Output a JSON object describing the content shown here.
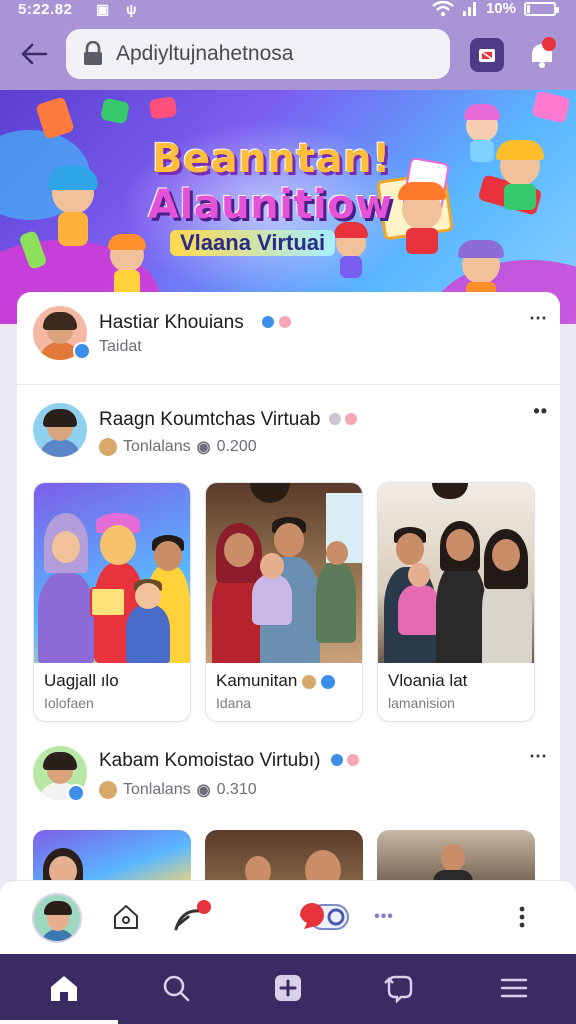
{
  "status_bar": {
    "time": "5:22.82",
    "battery": "10%",
    "battery_level": 0.1
  },
  "browser": {
    "url": "Apdiyltujnahetnosa",
    "back_icon": "arrow-left-icon",
    "lock_icon": "lock-icon",
    "tab_icon": "tab-switcher-icon",
    "notification_icon": "bell-icon"
  },
  "banner": {
    "line1": "Beanntan!",
    "line2": "Alaunitiow",
    "line3": "Vlaana Virtuai"
  },
  "posts": [
    {
      "name": "Hastiar Khouians",
      "meta": "Taidat",
      "more": "⋯"
    },
    {
      "name": "Raagn Koumtchas Virtuab",
      "meta_label": "Tonlalans",
      "meta_count": "0.200",
      "more": "••",
      "cards": [
        {
          "title": "Uagjall ılo",
          "subtitle": "Iolofaen"
        },
        {
          "title": "Kamunitan",
          "subtitle": "Idana"
        },
        {
          "title": "Vloania lat",
          "subtitle": "lamanision"
        }
      ]
    },
    {
      "name": "Kabam Komoistao Virtubı)",
      "meta_label": "Tonlalans",
      "meta_count": "0.310",
      "more": "⋯"
    }
  ],
  "colors": {
    "purple_bar": "#a995d6",
    "nav_bg": "#3a2b63",
    "verified_blue": "#3d8ee8",
    "accent_red": "#e8323c"
  }
}
